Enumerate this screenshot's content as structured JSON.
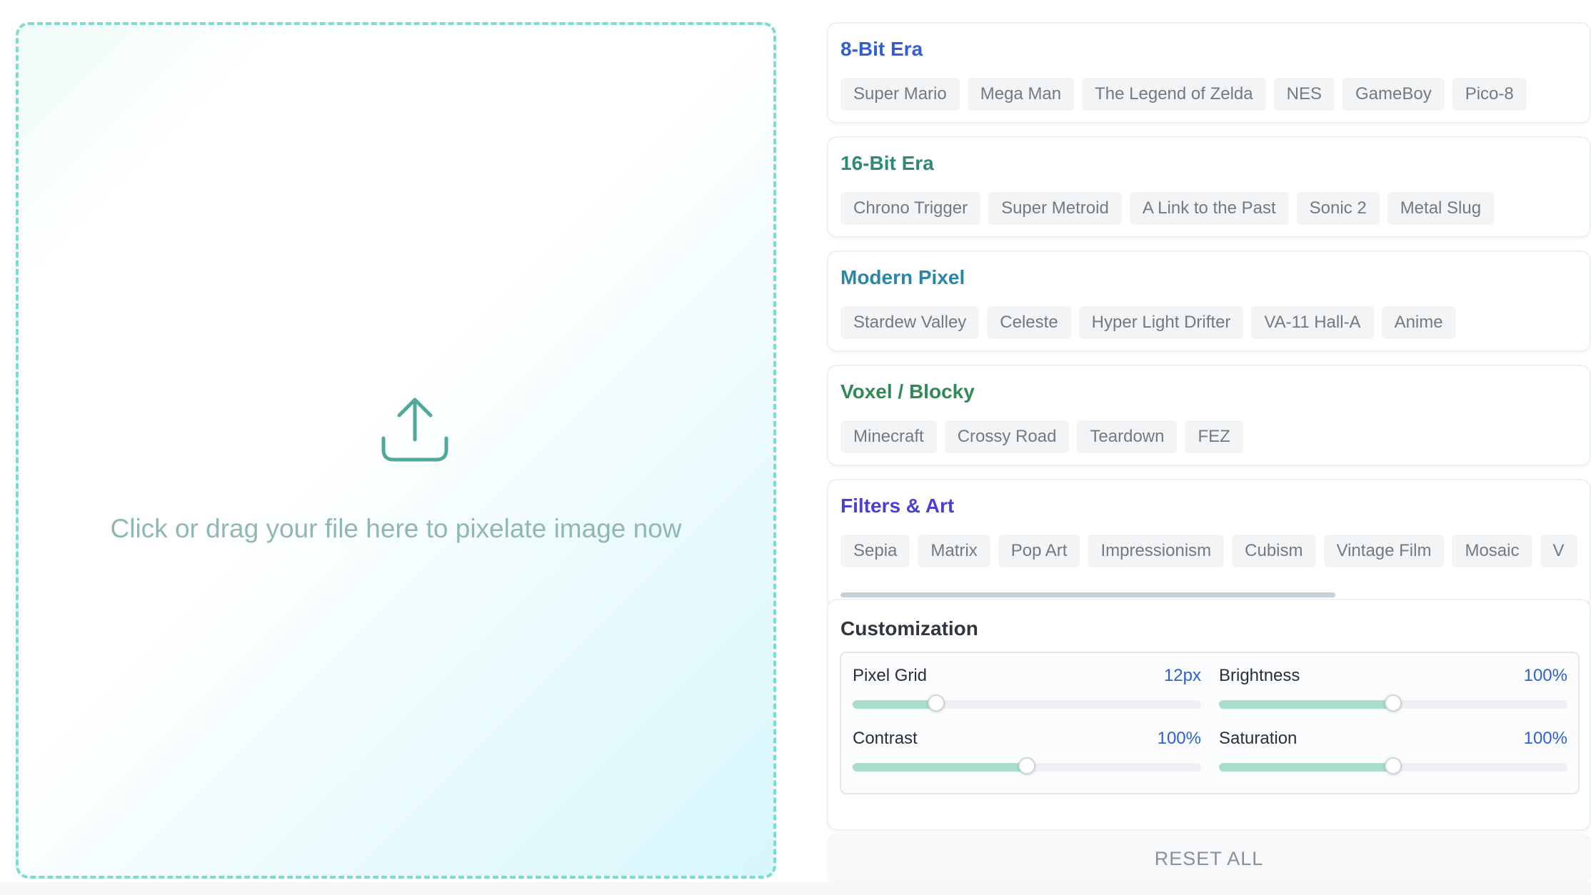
{
  "dropzone": {
    "text": "Click or drag your file here to pixelate image now",
    "icon": "upload-icon"
  },
  "categories": [
    {
      "title": "8-Bit Era",
      "color": "#2f5fd0",
      "chips": [
        "Super Mario",
        "Mega Man",
        "The Legend of Zelda",
        "NES",
        "GameBoy",
        "Pico-8"
      ]
    },
    {
      "title": "16-Bit Era",
      "color": "#2e8a74",
      "chips": [
        "Chrono Trigger",
        "Super Metroid",
        "A Link to the Past",
        "Sonic 2",
        "Metal Slug"
      ]
    },
    {
      "title": "Modern Pixel",
      "color": "#2a86a6",
      "chips": [
        "Stardew Valley",
        "Celeste",
        "Hyper Light Drifter",
        "VA-11 Hall-A",
        "Anime"
      ]
    },
    {
      "title": "Voxel / Blocky",
      "color": "#2f8a55",
      "chips": [
        "Minecraft",
        "Crossy Road",
        "Teardown",
        "FEZ"
      ]
    },
    {
      "title": "Filters & Art",
      "color": "#4b3fd0",
      "chips": [
        "Sepia",
        "Matrix",
        "Pop Art",
        "Impressionism",
        "Cubism",
        "Vintage Film",
        "Mosaic",
        "V"
      ]
    }
  ],
  "customization": {
    "title": "Customization",
    "controls": [
      {
        "label": "Pixel Grid",
        "value": "12px",
        "level": 0.24
      },
      {
        "label": "Brightness",
        "value": "100%",
        "level": 0.5
      },
      {
        "label": "Contrast",
        "value": "100%",
        "level": 0.5
      },
      {
        "label": "Saturation",
        "value": "100%",
        "level": 0.5
      }
    ]
  },
  "reset_label": "RESET ALL"
}
